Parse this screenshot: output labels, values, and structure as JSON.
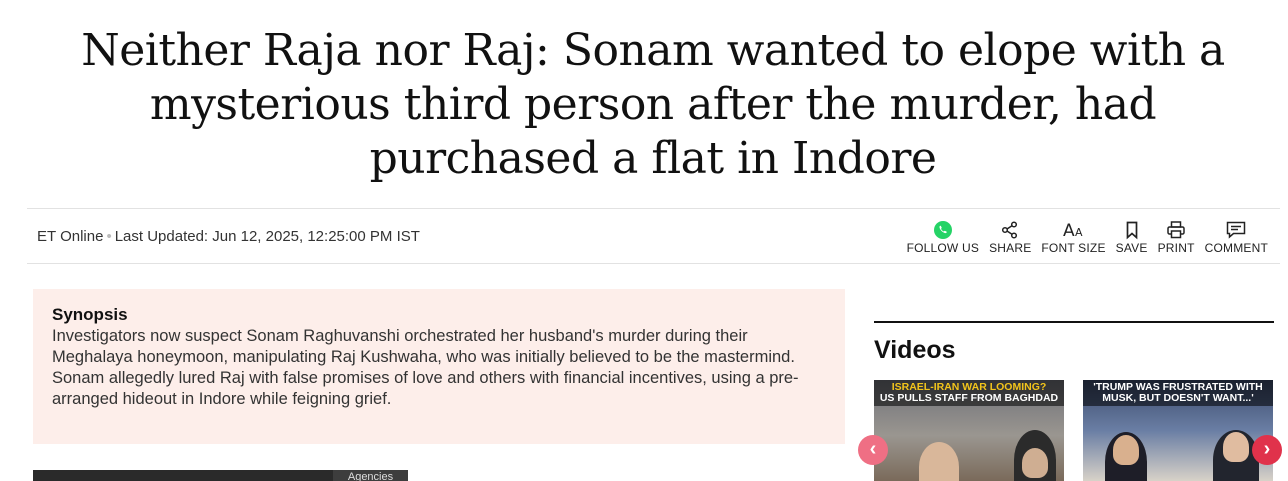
{
  "article": {
    "headline": "Neither Raja nor Raj: Sonam wanted to elope with a mysterious third person after the murder, had purchased a flat in Indore",
    "author": "ET Online",
    "last_updated": "Last Updated: Jun 12, 2025, 12:25:00 PM IST"
  },
  "actions": [
    {
      "label": "FOLLOW US",
      "icon": "whatsapp-icon"
    },
    {
      "label": "SHARE",
      "icon": "share-icon"
    },
    {
      "label": "FONT SIZE",
      "icon": "font-size-icon"
    },
    {
      "label": "SAVE",
      "icon": "bookmark-icon"
    },
    {
      "label": "PRINT",
      "icon": "printer-icon"
    },
    {
      "label": "COMMENT",
      "icon": "comment-icon"
    }
  ],
  "synopsis": {
    "title": "Synopsis",
    "text": "Investigators now suspect Sonam Raghuvanshi orchestrated her husband's murder during their Meghalaya honeymoon, manipulating Raj Kushwaha, who was initially believed to be the mastermind. Sonam allegedly lured Raj with false promises of love and others with financial incentives, using a pre-arranged hideout in Indore while feigning grief."
  },
  "image": {
    "tag": "Agencies"
  },
  "videos": {
    "title": "Videos",
    "items": [
      {
        "caption_line1": "ISRAEL-IRAN WAR LOOMING?",
        "caption_line2": "US PULLS STAFF FROM BAGHDAD"
      },
      {
        "caption_line1": "'TRUMP WAS FRUSTRATED WITH",
        "caption_line2": "MUSK, BUT DOESN'T WANT...'"
      }
    ],
    "prev_label": "‹",
    "next_label": "›"
  },
  "colors": {
    "accent": "#e0324b",
    "synopsis_bg": "#fdeeea",
    "whatsapp": "#25d366"
  }
}
